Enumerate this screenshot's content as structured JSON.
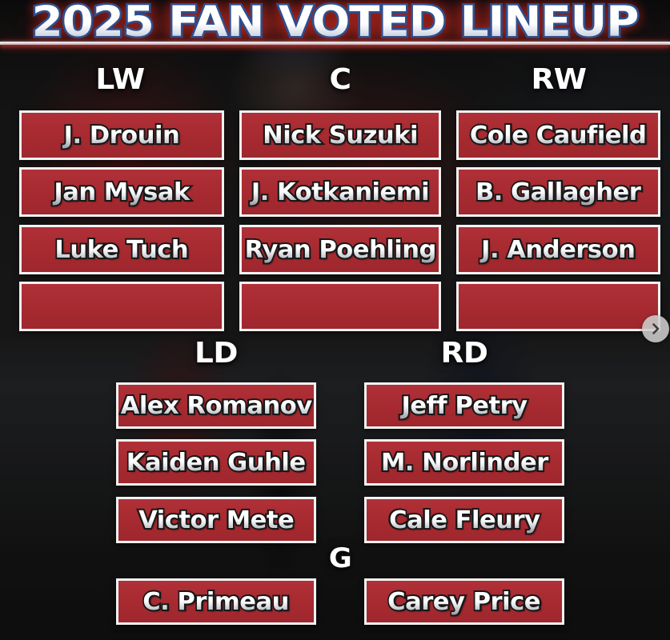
{
  "header": {
    "title": "2025 FAN VOTED LINEUP"
  },
  "forwards": {
    "columns": [
      {
        "position_label": "LW",
        "position_name": "left-wing",
        "players": [
          "J. Drouin",
          "Jan Mysak",
          "Luke Tuch",
          ""
        ]
      },
      {
        "position_label": "C",
        "position_name": "center",
        "players": [
          "Nick Suzuki",
          "J. Kotkaniemi",
          "Ryan Poehling",
          ""
        ]
      },
      {
        "position_label": "RW",
        "position_name": "right-wing",
        "players": [
          "Cole Caufield",
          "B. Gallagher",
          "J. Anderson",
          ""
        ]
      }
    ]
  },
  "defense": {
    "columns": [
      {
        "position_label": "LD",
        "position_name": "left-defense",
        "players": [
          "Alex Romanov",
          "Kaiden Guhle",
          "Victor Mete"
        ]
      },
      {
        "position_label": "RD",
        "position_name": "right-defense",
        "players": [
          "Jeff Petry",
          "M. Norlinder",
          "Cale Fleury"
        ]
      }
    ]
  },
  "goalies": {
    "position_label": "G",
    "position_name": "goalie",
    "players": [
      "C. Primeau",
      "Carey Price"
    ]
  },
  "controls": {
    "next_icon": "chevron-right-icon"
  },
  "colors": {
    "card_red": "#a82b31",
    "card_border": "#f2f2f2",
    "background": "#2a2a2a",
    "title_outline": "#2d4f8f",
    "title_glow": "#c4281e"
  }
}
